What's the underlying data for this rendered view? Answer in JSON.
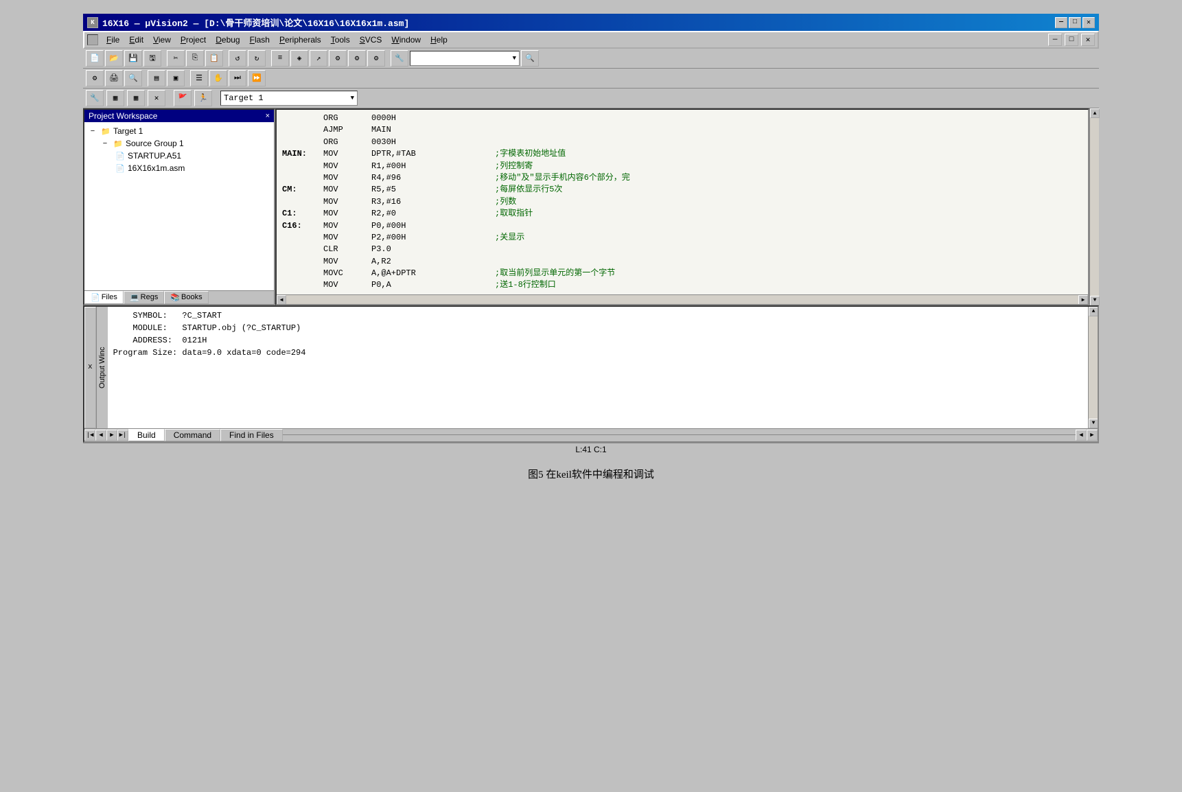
{
  "titleBar": {
    "text": "16X16  —  μVision2  —  [D:\\骨干师资培训\\论文\\16X16\\16X16x1m.asm]",
    "icon": "K",
    "controls": [
      "—",
      "□",
      "✕"
    ]
  },
  "menuBar": {
    "items": [
      "File",
      "Edit",
      "View",
      "Project",
      "Debug",
      "Flash",
      "Peripherals",
      "Tools",
      "SVCS",
      "Window",
      "Help"
    ],
    "controls": [
      "—",
      "□",
      "✕"
    ]
  },
  "targetToolbar": {
    "label": "Target 1"
  },
  "projectWorkspace": {
    "title": "Project Workspace",
    "closeBtn": "×",
    "tree": {
      "root": "Target 1",
      "sourceGroup": "Source Group 1",
      "files": [
        "STARTUP.A51",
        "16X16x1m.asm"
      ]
    },
    "tabs": [
      "Files",
      "Regs",
      "Books"
    ]
  },
  "codeEditor": {
    "lines": [
      {
        "label": "",
        "mnem": "ORG",
        "operand": "0000H",
        "comment": ""
      },
      {
        "label": "",
        "mnem": "AJMP",
        "operand": "MAIN",
        "comment": ""
      },
      {
        "label": "",
        "mnem": "ORG",
        "operand": "0030H",
        "comment": ""
      },
      {
        "label": "MAIN:",
        "mnem": "MOV",
        "operand": "DPTR,#TAB",
        "comment": ";字模表初始地址值"
      },
      {
        "label": "",
        "mnem": "MOV",
        "operand": "R1,#00H",
        "comment": ";列控制寄"
      },
      {
        "label": "",
        "mnem": "MOV",
        "operand": "R4,#96",
        "comment": ";移动\"及\"显示手机内容6个部分，完"
      },
      {
        "label": "CM:",
        "mnem": "MOV",
        "operand": "R5,#5",
        "comment": ";每屏依显示行5次"
      },
      {
        "label": "",
        "mnem": "MOV",
        "operand": "R3,#16",
        "comment": ";列数"
      },
      {
        "label": "C1:",
        "mnem": "MOV",
        "operand": "R2,#0",
        "comment": ";取取指针"
      },
      {
        "label": "C16:",
        "mnem": "MOV",
        "operand": "P0,#00H",
        "comment": ""
      },
      {
        "label": "",
        "mnem": "MOV",
        "operand": "P2,#00H",
        "comment": ";关显示"
      },
      {
        "label": "",
        "mnem": "CLR",
        "operand": "P3.0",
        "comment": ""
      },
      {
        "label": "",
        "mnem": "MOV",
        "operand": "A,R2",
        "comment": ""
      },
      {
        "label": "",
        "mnem": "MOVC",
        "operand": "A,@A+DPTR",
        "comment": ";取当前列显示单元的第一个字节"
      },
      {
        "label": "",
        "mnem": "MOV",
        "operand": "P0,A",
        "comment": ";送1-8行控制口"
      }
    ]
  },
  "outputArea": {
    "lines": [
      "    SYMBOL:   ?C_START",
      "    MODULE:   STARTUP.obj (?C_STARTUP)",
      "    ADDRESS:  0121H",
      "Program Size: data=9.0 xdata=0 code=294"
    ],
    "sideLabel": "Output Winc",
    "xLabel": "x",
    "tabs": [
      "Build",
      "Command",
      "Find in Files"
    ]
  },
  "statusBar": {
    "text": "L:41  C:1"
  },
  "figureCaption": "图5  在keil软件中编程和调试"
}
